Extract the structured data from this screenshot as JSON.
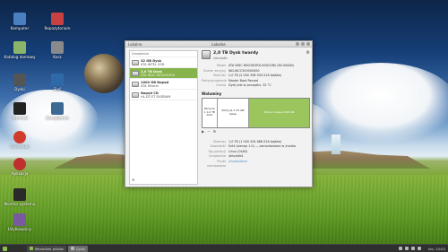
{
  "desktop": {
    "icons": [
      {
        "label": "Komputer",
        "icon": "computer-icon",
        "color": "#4a7fc0"
      },
      {
        "label": "Repozytorium",
        "icon": "trash-icon",
        "color": "#c94040"
      },
      {
        "label": "Katalog domowy",
        "icon": "home-folder-icon",
        "color": "#8bb56a"
      },
      {
        "label": "Kosz",
        "icon": "folder-icon",
        "color": "#8a8a8a"
      },
      {
        "label": "Dyski",
        "icon": "disks-icon",
        "color": "#555555"
      },
      {
        "label": "Sieć",
        "icon": "network-icon",
        "color": "#2e6aa8"
      },
      {
        "label": "Terminal",
        "icon": "terminal-icon",
        "color": "#222222"
      },
      {
        "label": "Zarządzanie",
        "icon": "settings-icon",
        "color": "#3d6a95"
      },
      {
        "label": "Chromium",
        "icon": "chrome-icon",
        "color": "#d03b2e"
      },
      {
        "label": "Aplikacja",
        "icon": "app-icon",
        "color": "#c02f2f"
      },
      {
        "label": "Monitor systemu",
        "icon": "monitor-icon",
        "color": "#2a2a2a"
      },
      {
        "label": "Użytkownicy",
        "icon": "users-icon",
        "color": "#7a5a9e"
      }
    ]
  },
  "window": {
    "app_label": "Lokalne",
    "title": "Lokalne",
    "sidebar_header": "Urządzenia",
    "disks": [
      {
        "name": "32 GB Dysk",
        "sub": "ATA INTEL SSD"
      },
      {
        "name": "2,0 TB Dysk",
        "sub": "ATA WDC WD20EZRX"
      },
      {
        "name": "1000 GB Napęd",
        "sub": "ATA Hitachi"
      },
      {
        "name": "Napęd CD",
        "sub": "HL-DT-ST DVDRAM"
      }
    ],
    "drive": {
      "title": "2,0 TB Dysk twardy",
      "subtitle": "/dev/sdb",
      "props": [
        {
          "k": "Model",
          "v": "ATA WDC WD20EZRX-00DC0B0 (80.00A80)"
        },
        {
          "k": "Numer seryjny",
          "v": "WD-WCC300000000"
        },
        {
          "k": "Rozmiar",
          "v": "2,0 TB (2 000 398 934 016 bajtów)"
        },
        {
          "k": "Partycjonowanie",
          "v": "Master Boot Record"
        },
        {
          "k": "Ocena",
          "v": "Dysk jest w porządku, 32 °C"
        }
      ]
    },
    "volumes_title": "Woluminy",
    "volumes": [
      {
        "label": "Partycja 1 1,0 TB ext4"
      },
      {
        "label": "Partycja 2 32 GB Swap"
      },
      {
        "label": "Wolne miejsce 968 GB"
      }
    ],
    "vprops": [
      {
        "k": "Rozmiar",
        "v": "1,0 TB (1 000 204 886 016 bajtów)"
      },
      {
        "k": "Zawartość",
        "v": "Ext4 (wersja 1.0) — zamontowane w /media"
      },
      {
        "k": "Typ partycji",
        "v": "Linux (0x83)"
      },
      {
        "k": "Urządzenie",
        "v": "/dev/sdb1"
      },
      {
        "k": "Punkt montowania",
        "v": "/media/dane"
      }
    ]
  },
  "taskbar": {
    "tasks": [
      {
        "label": "Menedżer plików"
      },
      {
        "label": "Dyski"
      }
    ],
    "clock": "śro, 14:02"
  }
}
